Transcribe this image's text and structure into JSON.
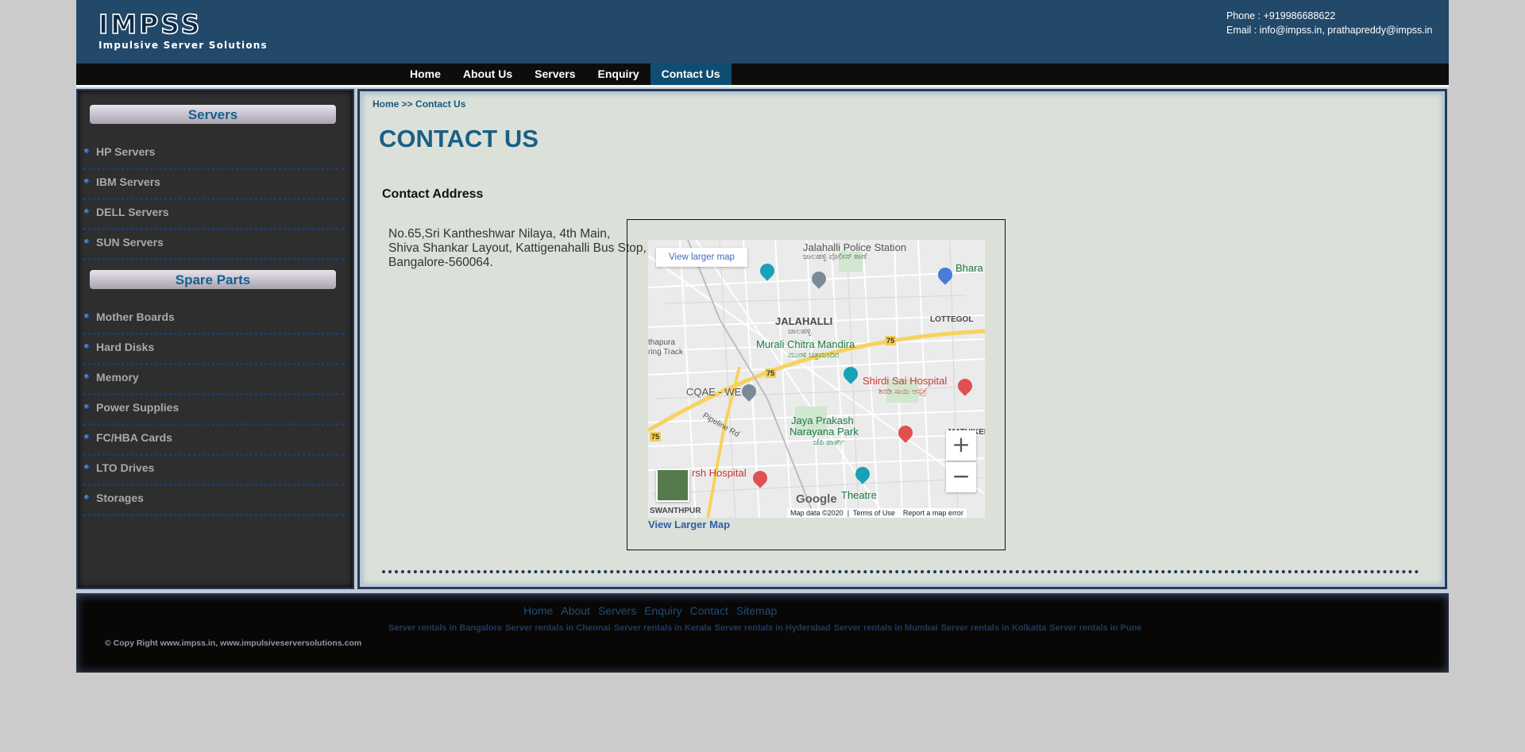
{
  "header": {
    "logo_mark": "IMPSS",
    "logo_tagline": "Impulsive Server Solutions",
    "phone": "Phone : +919986688622",
    "email": "Email  : info@impss.in, prathapreddy@impss.in"
  },
  "nav": {
    "items": [
      "Home",
      "About Us",
      "Servers",
      "Enquiry",
      "Contact Us"
    ],
    "active": "Contact Us"
  },
  "sidebar": {
    "servers_heading": "Servers",
    "servers": [
      "HP Servers",
      "IBM Servers",
      "DELL Servers",
      "SUN Servers"
    ],
    "parts_heading": "Spare Parts",
    "parts": [
      "Mother Boards",
      "Hard Disks",
      "Memory",
      "Power Supplies",
      "FC/HBA Cards",
      "LTO Drives",
      "Storages"
    ]
  },
  "content": {
    "breadcrumb": "Home >> Contact Us",
    "title": "CONTACT US",
    "address_heading": "Contact Address",
    "address_lines": [
      "No.65,Sri Kantheshwar Nilaya, 4th Main,",
      "Shiva Shankar Layout, Kattigenahalli Bus Stop,",
      "Bangalore-560064."
    ],
    "view_larger_map_link": "View Larger Map"
  },
  "map": {
    "view_larger_button": "View larger map",
    "zoom_in": "+",
    "zoom_out": "−",
    "google": "Google",
    "footer_data": "Map data ©2020",
    "footer_terms": "Terms of Use",
    "footer_report": "Report a map error",
    "labels": {
      "police": "Jalahalli Police Station",
      "police_kn": "ಜಾಲಹಳ್ಳಿ ಪೊಲೀಸ್ ಠಾಣೆ",
      "jalahalli": "JALAHALLI",
      "jalahalli_kn": "ಜಾಲಹಳ್ಳಿ",
      "murali": "Murali Chitra Mandira",
      "murali_kn": "ಮುರಳಿ ಚಿತ್ರಮಂದಿರ",
      "shirdi": "Shirdi Sai Hospital",
      "shirdi_kn": "ಶಿರಡಿ ಸಾಯಿ ಆಸ್ಪತ್ರೆ",
      "cqae": "CQAE - WE",
      "jaya": "Jaya Prakash",
      "jaya2": "Narayana Park",
      "jaya_kn": "ಜೆಪಿ ಪಾರ್ಕ್",
      "pipeline": "Pipeline Rd",
      "hospital": "rsh Hospital",
      "theatre": "Theatre",
      "lottegol": "LOTTEGOL",
      "mathikere": "MATHIKERE",
      "bharat": "Bhara ambe",
      "thapura": "thapura",
      "ring_track": "ring Track",
      "swanthpur": "SWANTHPUR",
      "road75": "75"
    }
  },
  "footer": {
    "links": [
      "Home",
      "About",
      "Servers",
      "Enquiry",
      "Contact",
      "Sitemap"
    ],
    "rentals": [
      "Server rentals in Bangalore",
      "Server rentals in Chennai",
      "Server rentals in Kerala",
      "Server rentals in Hyderabad",
      "Server rentals in Mumbai",
      "Server rentals in Kolkatta",
      "Server rentals in Pune"
    ],
    "copyright": "© Copy Right www.impss.in, www.impulsiveserversolutions.com"
  },
  "colors": {
    "header_bg": "#22486a",
    "nav_active": "#0f4e72",
    "title": "#1a5f84",
    "sidebar_bg": "#2e2e2e",
    "content_bg": "#dbe1d9"
  }
}
